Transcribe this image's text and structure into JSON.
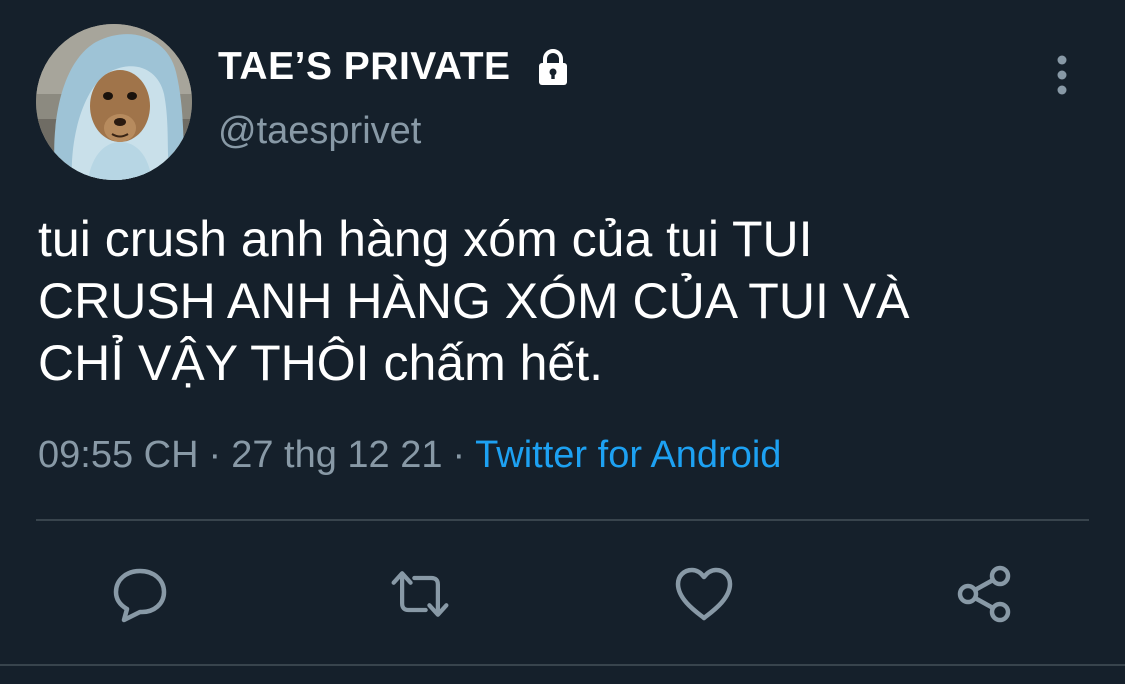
{
  "author": {
    "display_name": "TAE’S PRIVATE",
    "handle": "@taesprivet",
    "protected_icon": "lock-icon",
    "avatar": "dog-in-hoodie-avatar"
  },
  "tweet": {
    "text": "tui crush anh hàng xóm của tui TUI\nCRUSH ANH HÀNG XÓM CỦA TUI VÀ\nCHỈ VẬY THÔI chấm hết.",
    "time": "09:55 CH",
    "date": "27 thg 12 21",
    "separator": "·",
    "source": "Twitter for Android"
  },
  "actions": [
    {
      "icon": "reply-icon"
    },
    {
      "icon": "retweet-icon"
    },
    {
      "icon": "like-icon"
    },
    {
      "icon": "share-icon"
    }
  ],
  "menu_icon": "more-options-icon",
  "colors": {
    "background": "#15202b",
    "text": "#ffffff",
    "secondary_text": "#8899a6",
    "link": "#1da1f2",
    "divider": "#38444d"
  }
}
